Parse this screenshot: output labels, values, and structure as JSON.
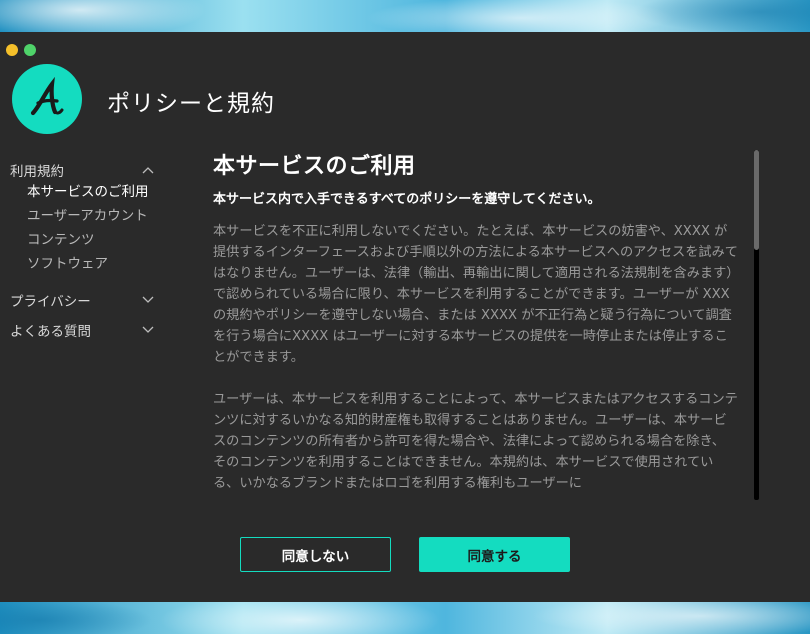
{
  "window": {
    "title": "ポリシーと規約",
    "logo_letter": "A"
  },
  "sidebar": {
    "sections": [
      {
        "label": "利用規約",
        "expanded": true,
        "items": [
          {
            "label": "本サービスのご利用",
            "active": true
          },
          {
            "label": "ユーザーアカウント"
          },
          {
            "label": "コンテンツ"
          },
          {
            "label": "ソフトウェア"
          }
        ]
      },
      {
        "label": "プライバシー",
        "expanded": false
      },
      {
        "label": "よくある質問",
        "expanded": false
      }
    ]
  },
  "content": {
    "title": "本サービスのご利用",
    "subtitle": "本サービス内で入手できるすべてのポリシーを遵守してください。",
    "paragraphs": [
      "本サービスを不正に利用しないでください。たとえば、本サービスの妨害や、XXXX が提供するインターフェースおよび手順以外の方法による本サービスへのアクセスを試みてはなりません。ユーザーは、法律（輸出、再輸出に関して適用される法規制を含みます）で認められている場合に限り、本サービスを利用することができます。ユーザーが XXX の規約やポリシーを遵守しない場合、または XXXX が不正行為と疑う行為について調査を行う場合にXXXX はユーザーに対する本サービスの提供を一時停止または停止することができます。",
      "ユーザーは、本サービスを利用することによって、本サービスまたはアクセスするコンテンツに対するいかなる知的財産権も取得することはありません。ユーザーは、本サービスのコンテンツの所有者から許可を得た場合や、法律によって認められる場合を除き、そのコンテンツを利用することはできません。本規約は、本サービスで使用されている、いかなるブランドまたはロゴを利用する権利もユーザーに"
    ]
  },
  "buttons": {
    "disagree": "同意しない",
    "agree": "同意する"
  },
  "colors": {
    "accent": "#14dcc0",
    "window_bg": "#2a2a2a",
    "traffic_yellow": "#f5c02a",
    "traffic_green": "#4fd36a"
  }
}
